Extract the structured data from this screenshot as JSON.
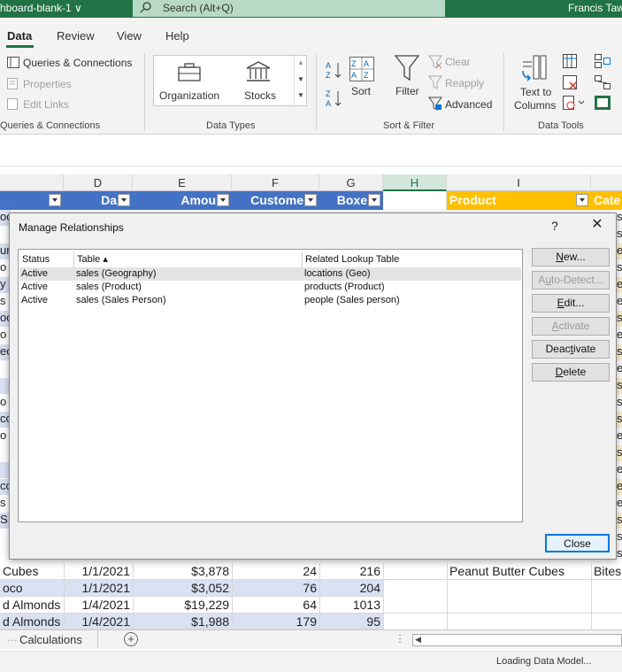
{
  "window": {
    "doc_name": "hboard-blank-1 ∨",
    "search_placeholder": "Search (Alt+Q)",
    "user": "Francis Taw"
  },
  "ribbon_tabs": [
    {
      "label": "Data",
      "active": true
    },
    {
      "label": "Review",
      "active": false
    },
    {
      "label": "View",
      "active": false
    },
    {
      "label": "Help",
      "active": false
    }
  ],
  "ribbon": {
    "queries": {
      "queries_connections": "Queries & Connections",
      "properties": "Properties",
      "edit_links": "Edit Links",
      "group_label": "Queries & Connections"
    },
    "data_types": {
      "organization": "Organization",
      "stocks": "Stocks",
      "group_label": "Data Types"
    },
    "sort_filter": {
      "sort": "Sort",
      "filter": "Filter",
      "clear": "Clear",
      "reapply": "Reapply",
      "advanced": "Advanced",
      "group_label": "Sort & Filter"
    },
    "data_tools": {
      "text_to_columns_1": "Text to",
      "text_to_columns_2": "Columns",
      "group_label": "Data Tools"
    }
  },
  "columns": {
    "D": "D",
    "E": "E",
    "F": "F",
    "G": "G",
    "H": "H",
    "I": "I"
  },
  "table_headers": {
    "date": "Da",
    "amount": "Amou",
    "customers": "Custome",
    "boxes": "Boxe",
    "product": "Product",
    "category": "Cate"
  },
  "left_slivers": [
    "oc",
    "",
    "ur",
    "o C",
    "y C",
    "s",
    "oc",
    "o",
    "ec",
    "",
    "",
    "o",
    "co",
    "o",
    "",
    "",
    "co",
    "s",
    "S",
    "",
    ""
  ],
  "right_slivers": [
    "s",
    "s",
    "e",
    "s",
    "e",
    "e",
    "s",
    "e",
    "s",
    "e",
    "s",
    "s",
    "s",
    "e",
    "s",
    "e",
    "e",
    "e",
    "s",
    "s",
    "s"
  ],
  "rows": [
    {
      "product_short": "Cubes",
      "date": "1/1/2021",
      "amount": "$3,878",
      "customers": "24",
      "boxes": "216",
      "product": "Peanut Butter Cubes",
      "category": "Bites"
    },
    {
      "product_short": "oco",
      "date": "1/1/2021",
      "amount": "$3,052",
      "customers": "76",
      "boxes": "204",
      "product": "",
      "category": ""
    },
    {
      "product_short": "d Almonds",
      "date": "1/4/2021",
      "amount": "$19,229",
      "customers": "64",
      "boxes": "1013",
      "product": "",
      "category": ""
    },
    {
      "product_short": "d Almonds",
      "date": "1/4/2021",
      "amount": "$1,988",
      "customers": "179",
      "boxes": "95",
      "product": "",
      "category": ""
    }
  ],
  "sheet_tab": "Calculations",
  "status": "Loading Data Model...",
  "dialog": {
    "title": "Manage Relationships",
    "help": "?",
    "close_x": "✕",
    "headers": {
      "status": "Status",
      "table": "Table ▴",
      "related": "Related Lookup Table"
    },
    "relationships": [
      {
        "status": "Active",
        "table": "sales (Geography)",
        "related": "locations (Geo)"
      },
      {
        "status": "Active",
        "table": "sales (Product)",
        "related": "products (Product)"
      },
      {
        "status": "Active",
        "table": "sales (Sales Person)",
        "related": "people (Sales person)"
      }
    ],
    "buttons": {
      "new_pre": "",
      "new_u": "N",
      "new_post": "ew...",
      "autodetect_pre": "A",
      "autodetect_u": "u",
      "autodetect_post": "to-Detect...",
      "edit_pre": "",
      "edit_u": "E",
      "edit_post": "dit...",
      "activate_pre": "",
      "activate_u": "A",
      "activate_post": "ctivate",
      "deactivate_pre": "Deac",
      "deactivate_u": "t",
      "deactivate_post": "ivate",
      "delete_pre": "",
      "delete_u": "D",
      "delete_post": "elete",
      "close": "Close"
    }
  }
}
